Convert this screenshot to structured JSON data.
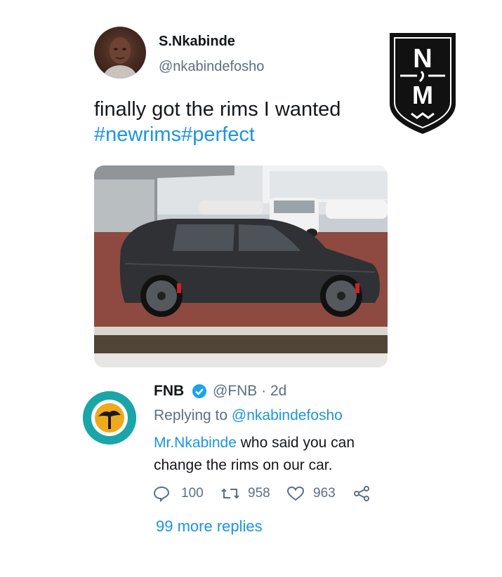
{
  "tweet": {
    "display_name": "S.Nkabinde",
    "handle": "@nkabindefosho",
    "text": "finally got the rims I wanted",
    "hashtags": [
      "#newrims",
      "#perfect"
    ]
  },
  "logo": {
    "top_letter": "N",
    "bottom_letter": "M"
  },
  "reply": {
    "display_name": "FNB",
    "handle_time": "@FNB · 2d",
    "replying_label": "Replying to ",
    "replying_to": "@nkabindefosho",
    "mention": "Mr.Nkabinde",
    "text_rest": " who said you can change the rims on our car.",
    "counts": {
      "replies": "100",
      "retweets": "958",
      "likes": "963"
    },
    "more_replies": "99 more replies"
  },
  "colors": {
    "link": "#1b95e0",
    "secondary": "#5b7083",
    "fnb_teal": "#1aa5a8"
  }
}
